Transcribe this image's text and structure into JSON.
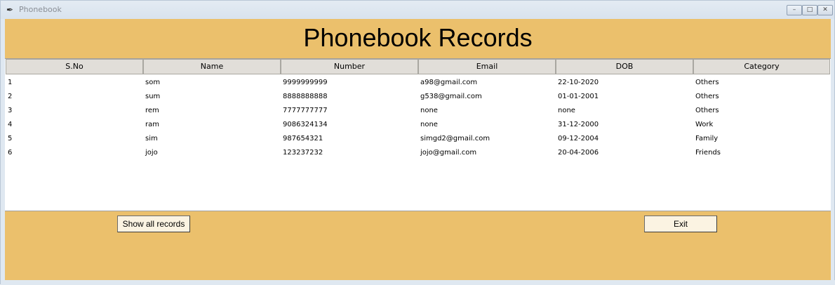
{
  "window": {
    "title": "Phonebook",
    "app_icon": "feather-icon"
  },
  "window_controls": {
    "minimize": "–",
    "maximize": "□",
    "close": "✕"
  },
  "heading": "Phonebook Records",
  "table": {
    "columns": [
      "S.No",
      "Name",
      "Number",
      "Email",
      "DOB",
      "Category"
    ],
    "rows": [
      [
        "1",
        "som",
        "9999999999",
        "a98@gmail.com",
        "22-10-2020",
        "Others"
      ],
      [
        "2",
        "sum",
        "8888888888",
        "g538@gmail.com",
        "01-01-2001",
        "Others"
      ],
      [
        "3",
        "rem",
        "7777777777",
        "none",
        "none",
        "Others"
      ],
      [
        "4",
        "ram",
        "9086324134",
        "none",
        "31-12-2000",
        "Work"
      ],
      [
        "5",
        "sim",
        "987654321",
        "simgd2@gmail.com",
        "09-12-2004",
        "Family"
      ],
      [
        "6",
        "jojo",
        "123237232",
        "jojo@gmail.com",
        "20-04-2006",
        "Friends"
      ]
    ]
  },
  "buttons": {
    "show_all": "Show all records",
    "exit": "Exit"
  },
  "colors": {
    "panel": "#ebc06c",
    "table_bg": "#ffffff",
    "header_bg": "#e1ded9"
  }
}
